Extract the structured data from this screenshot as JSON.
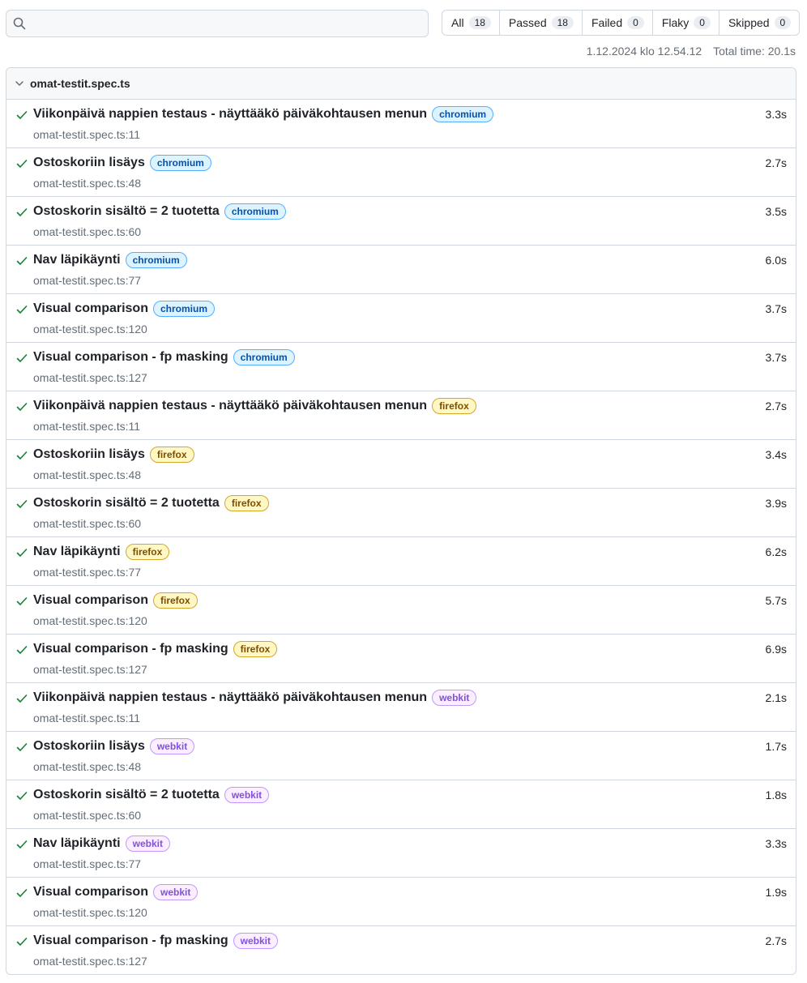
{
  "search": {
    "placeholder": "",
    "value": ""
  },
  "filters": [
    {
      "label": "All",
      "count": "18"
    },
    {
      "label": "Passed",
      "count": "18"
    },
    {
      "label": "Failed",
      "count": "0"
    },
    {
      "label": "Flaky",
      "count": "0"
    },
    {
      "label": "Skipped",
      "count": "0"
    }
  ],
  "meta": {
    "date": "1.12.2024 klo 12.54.12",
    "total_time": "Total time: 20.1s"
  },
  "file": {
    "name": "omat-testit.spec.ts",
    "tests": [
      {
        "title": "Viikonpäivä nappien testaus - näyttääkö päiväkohtausen menun",
        "project": "chromium",
        "location": "omat-testit.spec.ts:11",
        "duration": "3.3s"
      },
      {
        "title": "Ostoskoriin lisäys",
        "project": "chromium",
        "location": "omat-testit.spec.ts:48",
        "duration": "2.7s"
      },
      {
        "title": "Ostoskorin sisältö = 2 tuotetta",
        "project": "chromium",
        "location": "omat-testit.spec.ts:60",
        "duration": "3.5s"
      },
      {
        "title": "Nav läpikäynti",
        "project": "chromium",
        "location": "omat-testit.spec.ts:77",
        "duration": "6.0s"
      },
      {
        "title": "Visual comparison",
        "project": "chromium",
        "location": "omat-testit.spec.ts:120",
        "duration": "3.7s"
      },
      {
        "title": "Visual comparison - fp masking",
        "project": "chromium",
        "location": "omat-testit.spec.ts:127",
        "duration": "3.7s"
      },
      {
        "title": "Viikonpäivä nappien testaus - näyttääkö päiväkohtausen menun",
        "project": "firefox",
        "location": "omat-testit.spec.ts:11",
        "duration": "2.7s"
      },
      {
        "title": "Ostoskoriin lisäys",
        "project": "firefox",
        "location": "omat-testit.spec.ts:48",
        "duration": "3.4s"
      },
      {
        "title": "Ostoskorin sisältö = 2 tuotetta",
        "project": "firefox",
        "location": "omat-testit.spec.ts:60",
        "duration": "3.9s"
      },
      {
        "title": "Nav läpikäynti",
        "project": "firefox",
        "location": "omat-testit.spec.ts:77",
        "duration": "6.2s"
      },
      {
        "title": "Visual comparison",
        "project": "firefox",
        "location": "omat-testit.spec.ts:120",
        "duration": "5.7s"
      },
      {
        "title": "Visual comparison - fp masking",
        "project": "firefox",
        "location": "omat-testit.spec.ts:127",
        "duration": "6.9s"
      },
      {
        "title": "Viikonpäivä nappien testaus - näyttääkö päiväkohtausen menun",
        "project": "webkit",
        "location": "omat-testit.spec.ts:11",
        "duration": "2.1s"
      },
      {
        "title": "Ostoskoriin lisäys",
        "project": "webkit",
        "location": "omat-testit.spec.ts:48",
        "duration": "1.7s"
      },
      {
        "title": "Ostoskorin sisältö = 2 tuotetta",
        "project": "webkit",
        "location": "omat-testit.spec.ts:60",
        "duration": "1.8s"
      },
      {
        "title": "Nav läpikäynti",
        "project": "webkit",
        "location": "omat-testit.spec.ts:77",
        "duration": "3.3s"
      },
      {
        "title": "Visual comparison",
        "project": "webkit",
        "location": "omat-testit.spec.ts:120",
        "duration": "1.9s"
      },
      {
        "title": "Visual comparison - fp masking",
        "project": "webkit",
        "location": "omat-testit.spec.ts:127",
        "duration": "2.7s"
      }
    ]
  },
  "icons": {
    "search": "search-icon",
    "collapse": "chevron-down-icon",
    "status": "check-icon"
  },
  "colors": {
    "passed": "#1a7f37",
    "chromium": "#0550ae",
    "firefox": "#7d4e00",
    "webkit": "#8250df"
  }
}
